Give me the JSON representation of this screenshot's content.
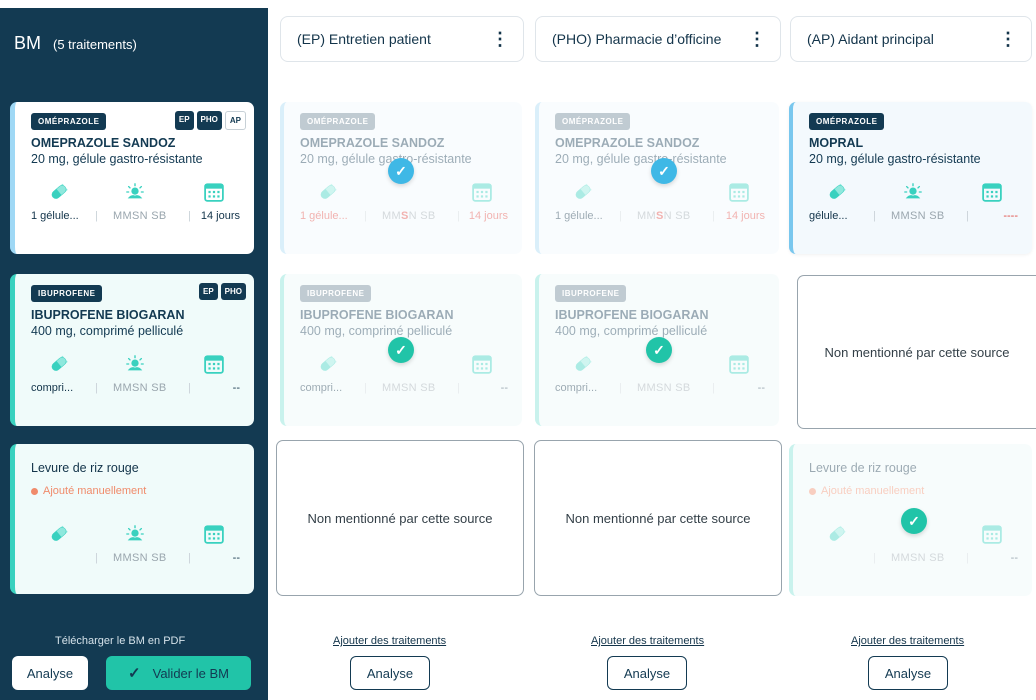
{
  "sidebar": {
    "title": "BM",
    "count": "(5 traitements)",
    "download": "Télécharger le BM en PDF",
    "analyse": "Analyse",
    "valider": "Valider le BM"
  },
  "columns": [
    {
      "title": "(EP) Entretien patient",
      "add": "Ajouter des traitements",
      "analyse": "Analyse"
    },
    {
      "title": "(PHO) Pharmacie d’officine",
      "add": "Ajouter des traitements",
      "analyse": "Analyse"
    },
    {
      "title": "(AP) Aidant principal",
      "add": "Ajouter des traitements",
      "analyse": "Analyse"
    }
  ],
  "sources": {
    "ep": "EP",
    "pho": "PHO",
    "ap": "AP"
  },
  "schedule": {
    "m": "M",
    "mi": "M",
    "s": "S",
    "n": "N",
    "sb": "SB"
  },
  "sep": "|",
  "not_mentioned": "Non mentionné par cette source",
  "rows": [
    {
      "tag": "OMÉPRAZOLE",
      "name": "OMEPRAZOLE SANDOZ",
      "form": "20 mg, gélule gastro-résistante",
      "dose": "1 gélule...",
      "duration": "14 jours",
      "ap_name": "MOPRAL",
      "ap_form": "20 mg, gélule gastro-résistante",
      "ap_dose": "gélule...",
      "ap_duration": "----"
    },
    {
      "tag": "IBUPROFENE",
      "name": "IBUPROFENE BIOGARAN",
      "form": "400 mg, comprimé pelliculé",
      "dose": "compri...",
      "duration": "--"
    },
    {
      "name": "Levure de riz rouge",
      "manual": "Ajouté manuellement",
      "dose": "",
      "duration": "--"
    }
  ],
  "colors": {
    "sidebar": "#133a52",
    "teal": "#21c4a8",
    "blue": "#3fb8e6",
    "alert": "#e04a44"
  }
}
